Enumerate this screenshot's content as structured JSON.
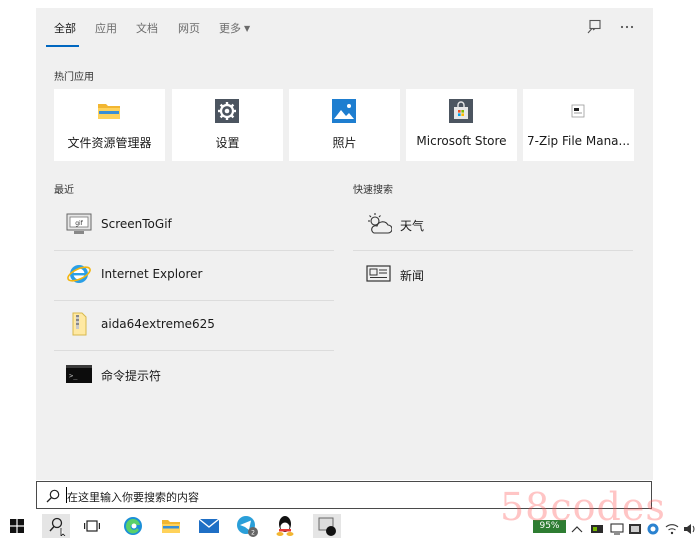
{
  "tabs": [
    {
      "label": "全部",
      "active": true
    },
    {
      "label": "应用",
      "active": false
    },
    {
      "label": "文档",
      "active": false
    },
    {
      "label": "网页",
      "active": false
    },
    {
      "label": "更多",
      "active": false
    }
  ],
  "header_icons": [
    "feedback-icon",
    "more-options-icon"
  ],
  "top_apps": {
    "title": "热门应用",
    "items": [
      {
        "label": "文件资源管理器",
        "icon": "file-explorer-icon"
      },
      {
        "label": "设置",
        "icon": "settings-gear-icon"
      },
      {
        "label": "照片",
        "icon": "photos-icon"
      },
      {
        "label": "Microsoft Store",
        "icon": "store-icon"
      },
      {
        "label": "7-Zip File Mana...",
        "icon": "7zip-icon"
      }
    ]
  },
  "recent": {
    "title": "最近",
    "items": [
      {
        "label": "ScreenToGif",
        "icon": "screentogif-icon"
      },
      {
        "label": "Internet Explorer",
        "icon": "internet-explorer-icon"
      },
      {
        "label": "aida64extreme625",
        "icon": "file-icon"
      },
      {
        "label": "命令提示符",
        "icon": "command-prompt-icon"
      }
    ]
  },
  "quick_search": {
    "title": "快速搜索",
    "items": [
      {
        "label": "天气",
        "icon": "weather-icon"
      },
      {
        "label": "新闻",
        "icon": "news-icon"
      }
    ]
  },
  "search": {
    "text": "在这里输入你要搜索的内容"
  },
  "taskbar": {
    "items": [
      "windows-start-icon",
      "search-icon",
      "task-view-icon",
      "edge-icon",
      "file-explorer-icon",
      "mail-icon",
      "telegram-icon",
      "qq-icon",
      "screen-app-icon"
    ],
    "battery_text": "95%"
  },
  "watermark": "58codes",
  "colors": {
    "accent": "#0067c0",
    "panel_bg": "#f0f0f0",
    "tile_bg": "#ffffff",
    "battery_badge": "#2e7d32"
  }
}
